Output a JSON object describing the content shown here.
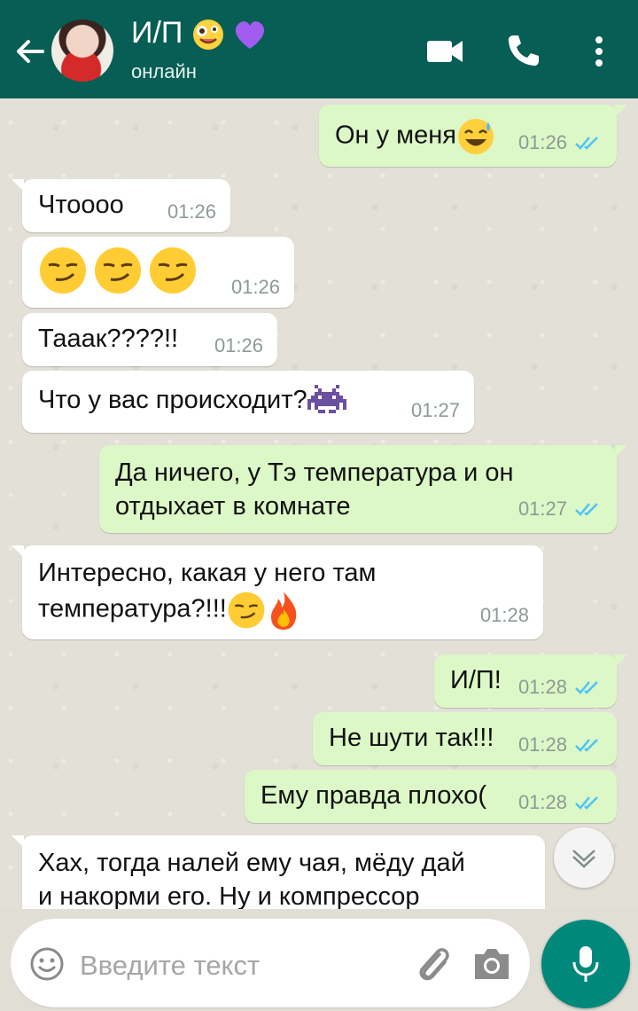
{
  "header": {
    "contact_name": "И/П",
    "status": "онлайн",
    "colors": {
      "bar": "#075e54",
      "accent_green": "#00897b"
    },
    "icons": [
      "back-arrow-icon",
      "avatar",
      "video-call-icon",
      "phone-icon",
      "more-vert-icon"
    ]
  },
  "messages": [
    {
      "dir": "out",
      "text": "Он у меня",
      "emoji": "sweat-smile",
      "time": "01:26",
      "read": true
    },
    {
      "dir": "in",
      "text": "Чтоооо",
      "time": "01:26"
    },
    {
      "dir": "in",
      "text": "",
      "emoji": "smirk-x3",
      "time": "01:26"
    },
    {
      "dir": "in",
      "text": "Тааак????!!",
      "time": "01:26"
    },
    {
      "dir": "in",
      "text": "Что у вас происходит?",
      "emoji": "alien-monster",
      "time": "01:27"
    },
    {
      "dir": "out",
      "line1": "Да ничего, у Тэ температура и он",
      "line2": "отдыхает в комнате",
      "time": "01:27",
      "read": true
    },
    {
      "dir": "in",
      "line1": "Интересно, какая у него там",
      "line2": "температура?!!!",
      "emoji": "smirk+fire",
      "time": "01:28"
    },
    {
      "dir": "out",
      "text": "И/П!",
      "time": "01:28",
      "read": true
    },
    {
      "dir": "out",
      "text": "Не шути так!!!",
      "time": "01:28",
      "read": true
    },
    {
      "dir": "out",
      "text": "Ему правда плохо(",
      "time": "01:28",
      "read": true
    },
    {
      "dir": "in",
      "line1": "Хах, тогда налей ему чая, мёду дай",
      "line2": "и накорми его. Ну и компрессор"
    }
  ],
  "input": {
    "placeholder": "Введите текст",
    "value": ""
  }
}
